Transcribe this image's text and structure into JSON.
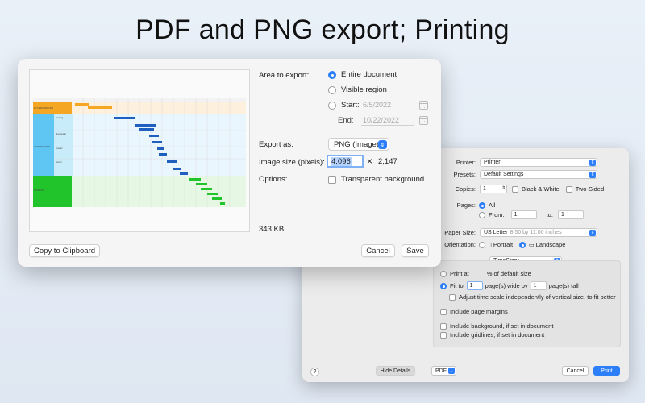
{
  "headline": "PDF and PNG export; Printing",
  "export": {
    "area_label": "Area to export:",
    "area_options": [
      "Entire document",
      "Visible region"
    ],
    "start_label": "Start:",
    "start_value": "6/5/2022",
    "end_label": "End:",
    "end_value": "10/22/2022",
    "export_as_label": "Export as:",
    "format_value": "PNG (Image)",
    "image_size_label": "Image size (pixels):",
    "width_value": "4,096",
    "times": "×",
    "height_value": "2,147",
    "options_label": "Options:",
    "transparent_label": "Transparent background",
    "file_size": "343 KB",
    "copy_button": "Copy to Clipboard",
    "cancel_button": "Cancel",
    "save_button": "Save",
    "accent": "#2d7ff9",
    "preview_rows": [
      "LOT & FOUNDATION",
      "CONSTRUCTION",
      "FINISHING"
    ],
    "preview_subrows": [
      "Framing",
      "Mechanical",
      "Exterior",
      "Interior"
    ]
  },
  "print": {
    "printer_label": "Printer:",
    "printer_value": "Printer",
    "presets_label": "Presets:",
    "presets_value": "Default Settings",
    "copies_label": "Copies:",
    "copies_value": "1",
    "bw_label": "Black & White",
    "two_sided_label": "Two-Sided",
    "pages_label": "Pages:",
    "pages_all": "All",
    "pages_from": "From:",
    "from_value": "1",
    "pages_to": "to:",
    "to_value": "1",
    "paper_label": "Paper Size:",
    "paper_value": "US Letter",
    "paper_dims": "8.50 by 11.00 inches",
    "orientation_label": "Orientation:",
    "portrait": "Portrait",
    "landscape": "Landscape",
    "app_select": "TimeStory",
    "print_at": "Print at",
    "print_at_suffix": "% of default size",
    "fit_to": "Fit to",
    "fit_wide_value": "1",
    "fit_wide_suffix": "page(s) wide by",
    "fit_tall_value": "1",
    "fit_tall_suffix": "page(s) tall",
    "adjust_scale": "Adjust time scale independently of vertical size, to fit better",
    "page_margins": "Include page margins",
    "include_background": "Include background, if set in document",
    "include_gridlines": "Include gridlines, if set in document",
    "help": "?",
    "hide_details": "Hide Details",
    "pdf_button": "PDF",
    "cancel_button": "Cancel",
    "print_button": "Print"
  }
}
